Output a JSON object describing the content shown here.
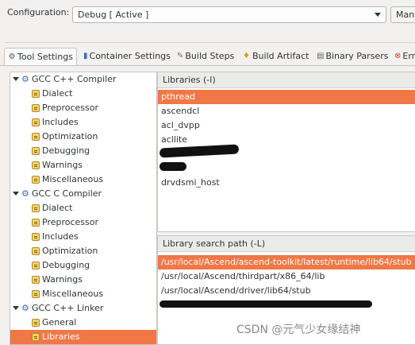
{
  "config": {
    "label": "Configuration:",
    "value": "Debug [ Active ]",
    "manage_label": "Mana"
  },
  "tabs": [
    {
      "label": "Tool Settings",
      "icon": "tool-settings-icon",
      "active": true
    },
    {
      "label": "Container Settings",
      "icon": "container-icon",
      "active": false
    },
    {
      "label": "Build Steps",
      "icon": "build-steps-icon",
      "active": false
    },
    {
      "label": "Build Artifact",
      "icon": "build-artifact-icon",
      "active": false
    },
    {
      "label": "Binary Parsers",
      "icon": "binary-parsers-icon",
      "active": false
    },
    {
      "label": "Err",
      "icon": "error-parsers-icon",
      "active": false
    }
  ],
  "tree": [
    {
      "label": "GCC C++ Compiler",
      "kind": "tool",
      "expanded": true
    },
    {
      "label": "Dialect",
      "kind": "page"
    },
    {
      "label": "Preprocessor",
      "kind": "page"
    },
    {
      "label": "Includes",
      "kind": "page"
    },
    {
      "label": "Optimization",
      "kind": "page"
    },
    {
      "label": "Debugging",
      "kind": "page"
    },
    {
      "label": "Warnings",
      "kind": "page"
    },
    {
      "label": "Miscellaneous",
      "kind": "page"
    },
    {
      "label": "GCC C Compiler",
      "kind": "tool",
      "expanded": true
    },
    {
      "label": "Dialect",
      "kind": "page"
    },
    {
      "label": "Preprocessor",
      "kind": "page"
    },
    {
      "label": "Includes",
      "kind": "page"
    },
    {
      "label": "Optimization",
      "kind": "page"
    },
    {
      "label": "Debugging",
      "kind": "page"
    },
    {
      "label": "Warnings",
      "kind": "page"
    },
    {
      "label": "Miscellaneous",
      "kind": "page"
    },
    {
      "label": "GCC C++ Linker",
      "kind": "tool",
      "expanded": true
    },
    {
      "label": "General",
      "kind": "page"
    },
    {
      "label": "Libraries",
      "kind": "page",
      "selected": true
    }
  ],
  "libraries": {
    "header": "Libraries (-l)",
    "items": [
      {
        "label": "pthread",
        "selected": true
      },
      {
        "label": "ascendcl"
      },
      {
        "label": "acl_dvpp"
      },
      {
        "label": "acllite"
      },
      {
        "label": ""
      },
      {
        "label": ""
      },
      {
        "label": "drvdsmi_host"
      }
    ]
  },
  "search_paths": {
    "header": "Library search path (-L)",
    "items": [
      {
        "label": "/usr/local/Ascend/ascend-toolkit/latest/runtime/lib64/stub",
        "selected": true
      },
      {
        "label": "/usr/local/Ascend/thirdpart/x86_64/lib"
      },
      {
        "label": "/usr/local/Ascend/driver/lib64/stub"
      },
      {
        "label": ""
      }
    ]
  },
  "watermark": "CSDN @元气少女缘结神",
  "colors": {
    "selection": "#f07746",
    "tool_icon": "#3b6db4"
  }
}
